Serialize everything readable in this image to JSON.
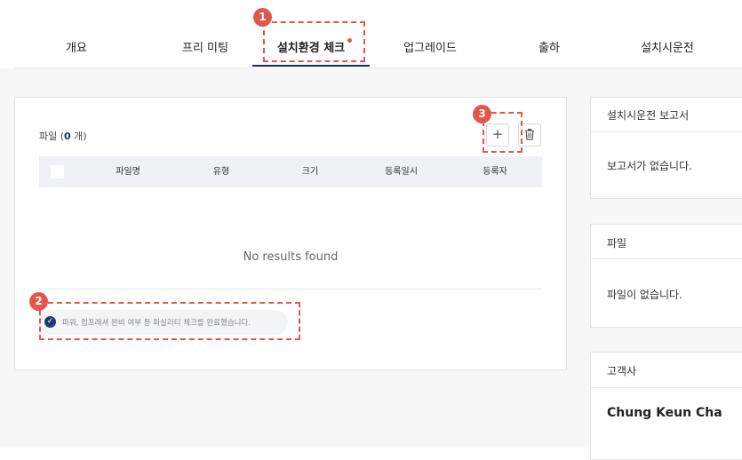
{
  "tabs": [
    {
      "label": "개요"
    },
    {
      "label": "프리 미팅"
    },
    {
      "label": "설치환경 체크"
    },
    {
      "label": "업그레이드"
    },
    {
      "label": "출하"
    },
    {
      "label": "설치시운전"
    }
  ],
  "files": {
    "title_prefix": "파일 (",
    "count": "0",
    "title_suffix": " 개)",
    "add_label": "+",
    "columns": [
      "파일명",
      "유형",
      "크기",
      "등록일시",
      "등록자"
    ],
    "empty_text": "No results found",
    "checklist_text": "파워, 컴프레셔 완비 여부 등 퍼실리티 체크를 완료했습니다."
  },
  "side": {
    "report": {
      "title": "설치시운전 보고서",
      "body": "보고서가 없습니다."
    },
    "file": {
      "title": "파일",
      "body": "파일이 없습니다."
    },
    "customer": {
      "title": "고객사",
      "name": "Chung Keun Cha"
    }
  },
  "annotations": [
    "1",
    "2",
    "3"
  ],
  "colors": {
    "accent": "#1c2a56",
    "annotation": "#e2574c"
  }
}
